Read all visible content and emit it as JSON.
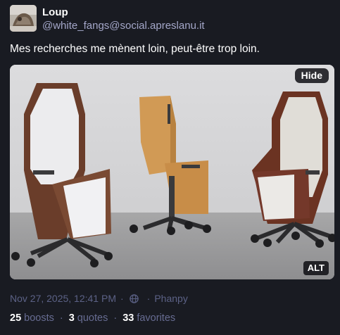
{
  "account": {
    "display_name": "Loup",
    "handle": "@white_fangs@social.apreslanu.it",
    "avatar_icon": "avatar-image"
  },
  "post": {
    "text": "Mes recherches me mènent loin, peut-être trop loin.",
    "timestamp": "Nov 27, 2025, 12:41 PM",
    "visibility_icon": "globe-icon",
    "client": "Phanpy"
  },
  "media": {
    "hide_label": "Hide",
    "alt_label": "ALT"
  },
  "stats": {
    "boosts_count": "25",
    "boosts_label": "boosts",
    "quotes_count": "3",
    "quotes_label": "quotes",
    "favorites_count": "33",
    "favorites_label": "favorites"
  },
  "colors": {
    "background": "#191b22",
    "muted_text": "#5c6286",
    "handle_text": "#a4a7c9"
  }
}
